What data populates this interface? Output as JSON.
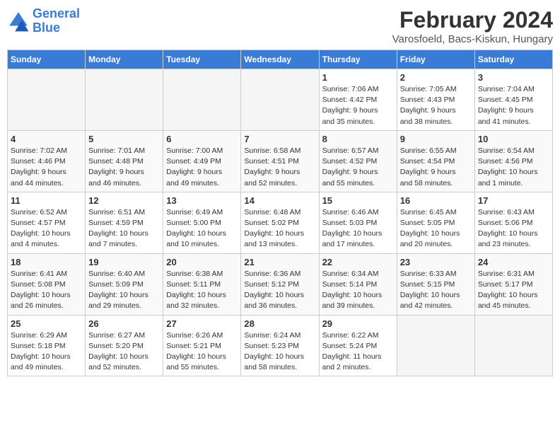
{
  "header": {
    "logo_line1": "General",
    "logo_line2": "Blue",
    "title": "February 2024",
    "subtitle": "Varosfoeld, Bacs-Kiskun, Hungary"
  },
  "days_of_week": [
    "Sunday",
    "Monday",
    "Tuesday",
    "Wednesday",
    "Thursday",
    "Friday",
    "Saturday"
  ],
  "weeks": [
    [
      {
        "day": "",
        "info": ""
      },
      {
        "day": "",
        "info": ""
      },
      {
        "day": "",
        "info": ""
      },
      {
        "day": "",
        "info": ""
      },
      {
        "day": "1",
        "info": "Sunrise: 7:06 AM\nSunset: 4:42 PM\nDaylight: 9 hours\nand 35 minutes."
      },
      {
        "day": "2",
        "info": "Sunrise: 7:05 AM\nSunset: 4:43 PM\nDaylight: 9 hours\nand 38 minutes."
      },
      {
        "day": "3",
        "info": "Sunrise: 7:04 AM\nSunset: 4:45 PM\nDaylight: 9 hours\nand 41 minutes."
      }
    ],
    [
      {
        "day": "4",
        "info": "Sunrise: 7:02 AM\nSunset: 4:46 PM\nDaylight: 9 hours\nand 44 minutes."
      },
      {
        "day": "5",
        "info": "Sunrise: 7:01 AM\nSunset: 4:48 PM\nDaylight: 9 hours\nand 46 minutes."
      },
      {
        "day": "6",
        "info": "Sunrise: 7:00 AM\nSunset: 4:49 PM\nDaylight: 9 hours\nand 49 minutes."
      },
      {
        "day": "7",
        "info": "Sunrise: 6:58 AM\nSunset: 4:51 PM\nDaylight: 9 hours\nand 52 minutes."
      },
      {
        "day": "8",
        "info": "Sunrise: 6:57 AM\nSunset: 4:52 PM\nDaylight: 9 hours\nand 55 minutes."
      },
      {
        "day": "9",
        "info": "Sunrise: 6:55 AM\nSunset: 4:54 PM\nDaylight: 9 hours\nand 58 minutes."
      },
      {
        "day": "10",
        "info": "Sunrise: 6:54 AM\nSunset: 4:56 PM\nDaylight: 10 hours\nand 1 minute."
      }
    ],
    [
      {
        "day": "11",
        "info": "Sunrise: 6:52 AM\nSunset: 4:57 PM\nDaylight: 10 hours\nand 4 minutes."
      },
      {
        "day": "12",
        "info": "Sunrise: 6:51 AM\nSunset: 4:59 PM\nDaylight: 10 hours\nand 7 minutes."
      },
      {
        "day": "13",
        "info": "Sunrise: 6:49 AM\nSunset: 5:00 PM\nDaylight: 10 hours\nand 10 minutes."
      },
      {
        "day": "14",
        "info": "Sunrise: 6:48 AM\nSunset: 5:02 PM\nDaylight: 10 hours\nand 13 minutes."
      },
      {
        "day": "15",
        "info": "Sunrise: 6:46 AM\nSunset: 5:03 PM\nDaylight: 10 hours\nand 17 minutes."
      },
      {
        "day": "16",
        "info": "Sunrise: 6:45 AM\nSunset: 5:05 PM\nDaylight: 10 hours\nand 20 minutes."
      },
      {
        "day": "17",
        "info": "Sunrise: 6:43 AM\nSunset: 5:06 PM\nDaylight: 10 hours\nand 23 minutes."
      }
    ],
    [
      {
        "day": "18",
        "info": "Sunrise: 6:41 AM\nSunset: 5:08 PM\nDaylight: 10 hours\nand 26 minutes."
      },
      {
        "day": "19",
        "info": "Sunrise: 6:40 AM\nSunset: 5:09 PM\nDaylight: 10 hours\nand 29 minutes."
      },
      {
        "day": "20",
        "info": "Sunrise: 6:38 AM\nSunset: 5:11 PM\nDaylight: 10 hours\nand 32 minutes."
      },
      {
        "day": "21",
        "info": "Sunrise: 6:36 AM\nSunset: 5:12 PM\nDaylight: 10 hours\nand 36 minutes."
      },
      {
        "day": "22",
        "info": "Sunrise: 6:34 AM\nSunset: 5:14 PM\nDaylight: 10 hours\nand 39 minutes."
      },
      {
        "day": "23",
        "info": "Sunrise: 6:33 AM\nSunset: 5:15 PM\nDaylight: 10 hours\nand 42 minutes."
      },
      {
        "day": "24",
        "info": "Sunrise: 6:31 AM\nSunset: 5:17 PM\nDaylight: 10 hours\nand 45 minutes."
      }
    ],
    [
      {
        "day": "25",
        "info": "Sunrise: 6:29 AM\nSunset: 5:18 PM\nDaylight: 10 hours\nand 49 minutes."
      },
      {
        "day": "26",
        "info": "Sunrise: 6:27 AM\nSunset: 5:20 PM\nDaylight: 10 hours\nand 52 minutes."
      },
      {
        "day": "27",
        "info": "Sunrise: 6:26 AM\nSunset: 5:21 PM\nDaylight: 10 hours\nand 55 minutes."
      },
      {
        "day": "28",
        "info": "Sunrise: 6:24 AM\nSunset: 5:23 PM\nDaylight: 10 hours\nand 58 minutes."
      },
      {
        "day": "29",
        "info": "Sunrise: 6:22 AM\nSunset: 5:24 PM\nDaylight: 11 hours\nand 2 minutes."
      },
      {
        "day": "",
        "info": ""
      },
      {
        "day": "",
        "info": ""
      }
    ]
  ]
}
